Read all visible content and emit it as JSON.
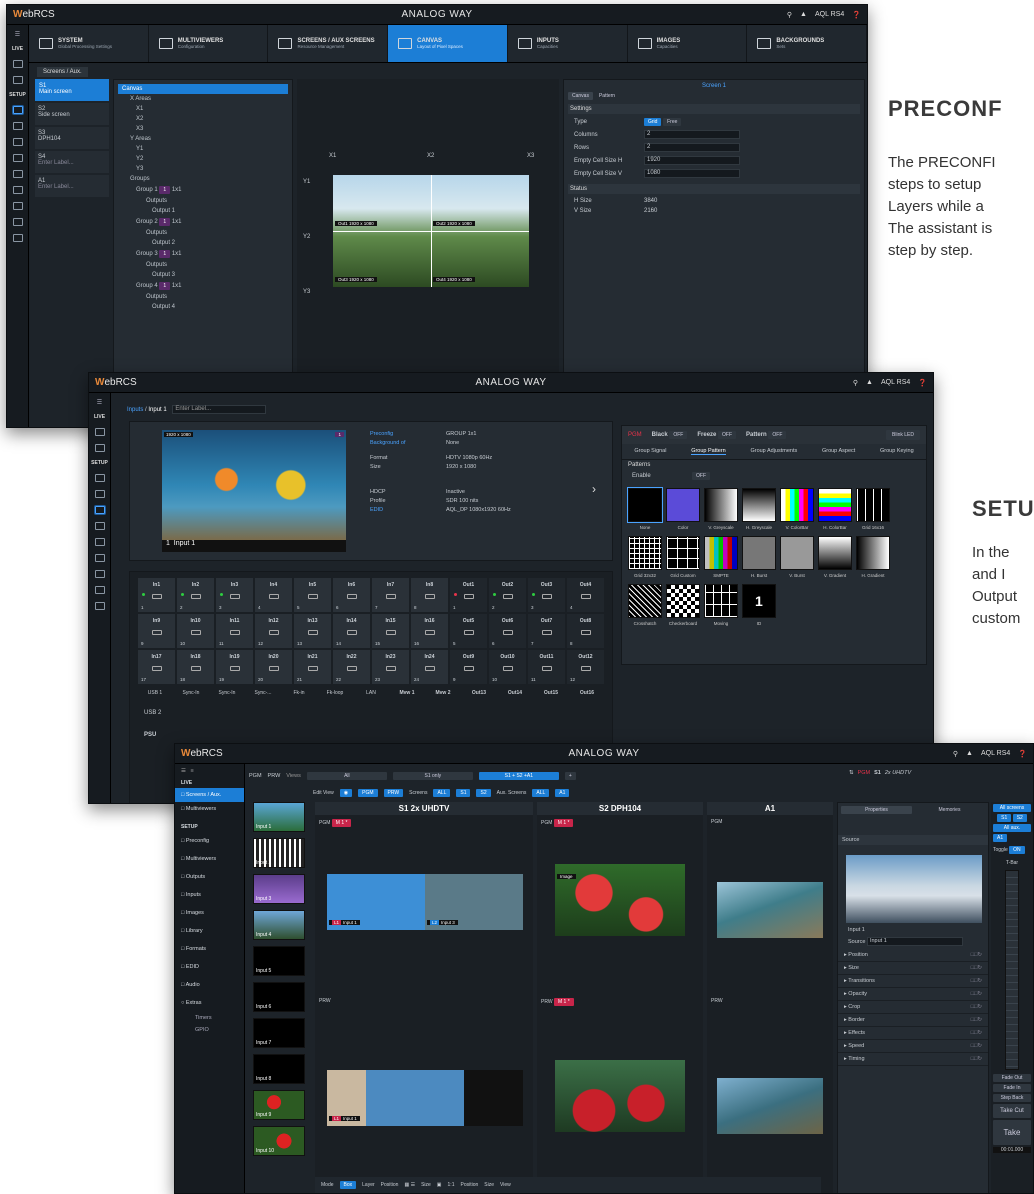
{
  "app": {
    "logo_w": "W",
    "logo_rest": "ebRCS",
    "brand": "ANALOG WAY",
    "device": "AQL RS4"
  },
  "side_text": {
    "s1_title": "PRECONF",
    "s1_body": [
      "The PRECONFI",
      "steps to setup",
      "Layers while a",
      "The assistant is",
      "step by step."
    ],
    "s2_title": "SETU",
    "s2_body": [
      "In the",
      "and I",
      "Output",
      "custom"
    ]
  },
  "s1": {
    "nav_live": "LIVE",
    "nav_setup": "SETUP",
    "tabs": [
      {
        "t": "SYSTEM",
        "s": "Global Processing Settings"
      },
      {
        "t": "MULTIVIEWERS",
        "s": "Configuration"
      },
      {
        "t": "SCREENS / AUX SCREENS",
        "s": "Resource Management"
      },
      {
        "t": "CANVAS",
        "s": "Layout of Pixel Spaces"
      },
      {
        "t": "INPUTS",
        "s": "Capacities"
      },
      {
        "t": "IMAGES",
        "s": "Capacities"
      },
      {
        "t": "BACKGROUNDS",
        "s": "Sets"
      }
    ],
    "subtab": "Screens / Aux.",
    "screens": [
      {
        "id": "S1",
        "label": "Main screen"
      },
      {
        "id": "S2",
        "label": "Side screen"
      },
      {
        "id": "S3",
        "label": "DPH104"
      },
      {
        "id": "S4",
        "label": "Enter Label..."
      },
      {
        "id": "A1",
        "label": "Enter Label..."
      }
    ],
    "tree": [
      "Canvas",
      "X Areas",
      "X1",
      "X2",
      "X3",
      "Y Areas",
      "Y1",
      "Y2",
      "Y3",
      "Groups",
      "Group 1",
      "Outputs",
      "Output 1",
      "Group 2",
      "Outputs",
      "Output 2",
      "Group 3",
      "Outputs",
      "Output 3",
      "Group 4",
      "Outputs",
      "Output 4"
    ],
    "group_badge": "1",
    "group_size": "1x1",
    "canvas_x": [
      "X1",
      "X2",
      "X3"
    ],
    "canvas_y": [
      "Y1",
      "Y2",
      "Y3"
    ],
    "outs": [
      {
        "o": "Out1",
        "r": "1920 x 1080"
      },
      {
        "o": "Out2",
        "r": "1920 x 1080"
      },
      {
        "o": "Out3",
        "r": "1920 x 1080"
      },
      {
        "o": "Out4",
        "r": "1920 x 1080"
      }
    ],
    "screen_title": "Screen 1",
    "ptabs": [
      "Canvas",
      "Pattern"
    ],
    "settings": "Settings",
    "type_l": "Type",
    "type_a": "Grid",
    "type_b": "Free",
    "fields": [
      {
        "l": "Columns",
        "v": "2"
      },
      {
        "l": "Rows",
        "v": "2"
      },
      {
        "l": "Empty Cell Size H",
        "v": "1920"
      },
      {
        "l": "Empty Cell Size V",
        "v": "1080"
      }
    ],
    "status": "Status",
    "hsize_l": "H Size",
    "hsize": "3840",
    "vsize_l": "V Size",
    "vsize": "2160"
  },
  "s2": {
    "crumb_a": "Inputs",
    "crumb_b": "Input 1",
    "crumb_ph": "Enter Label...",
    "preview_res": "1920 x 1080",
    "preview_name": "Input 1",
    "preview_num": "1",
    "info": [
      {
        "l": "Preconfig",
        "v": "GROUP 1x1"
      },
      {
        "l": "Background of",
        "v": "None"
      },
      {
        "l": "Format",
        "v": "HDTV 1080p 60Hz"
      },
      {
        "l": "Size",
        "v": "1920 x 1080"
      },
      {
        "l": "HDCP",
        "v": "Inactive"
      },
      {
        "l": "Profile",
        "v": "SDR 100 nits"
      },
      {
        "l": "EDID",
        "v": "AQL_DP 1080x1920 60Hz"
      }
    ],
    "bar": {
      "pgm": "PGM",
      "black": "Black",
      "freeze": "Freeze",
      "pattern": "Pattern",
      "off": "OFF",
      "blink": "Blink LED"
    },
    "ptabs": [
      "Group Signal",
      "Group Pattern",
      "Group Adjustments",
      "Group Aspect",
      "Group Keying"
    ],
    "patterns_h": "Patterns",
    "enable_l": "Enable",
    "enable_v": "OFF",
    "patterns": [
      "None",
      "Color",
      "V. Greyscale",
      "H. Greyscale",
      "V. ColorBar",
      "H. ColorBar",
      "Grid 16x16",
      "Grid 32x32",
      "Grid Custom",
      "SMPTE",
      "H. Burst",
      "V. Burst",
      "V. Gradient",
      "H. Gradient",
      "Crosshatch",
      "Checkerboard",
      "Moving",
      "ID"
    ],
    "io": [
      "In1",
      "In2",
      "In3",
      "In4",
      "In5",
      "In6",
      "In7",
      "In8",
      "Out1",
      "Out2",
      "Out3",
      "Out4",
      "In9",
      "In10",
      "In11",
      "In12",
      "In13",
      "In14",
      "In15",
      "In16",
      "Out5",
      "Out6",
      "Out7",
      "Out8",
      "In17",
      "In18",
      "In19",
      "In20",
      "In21",
      "In22",
      "In23",
      "In24",
      "Out9",
      "Out10",
      "Out11",
      "Out12"
    ],
    "io_nums": [
      "1",
      "2",
      "3",
      "4",
      "5",
      "6",
      "7",
      "8",
      "1",
      "2",
      "3",
      "4",
      "9",
      "10",
      "11",
      "12",
      "13",
      "14",
      "15",
      "16",
      "5",
      "6",
      "7",
      "8",
      "17",
      "18",
      "19",
      "20",
      "21",
      "22",
      "23",
      "24",
      "9",
      "10",
      "11",
      "12"
    ],
    "bottom": [
      "USB 1",
      "Sync-In",
      "Sync-In",
      "Sync-...",
      "Fk-in",
      "Fk-loop",
      "LAN",
      "Mvw 1",
      "Mvw 2",
      "Out13",
      "Out14",
      "Out15",
      "Out16"
    ],
    "usb2": "USB 2",
    "psu": "PSU"
  },
  "s3": {
    "nav": [
      "LIVE",
      "Screens / Aux.",
      "Multiviewers",
      "SETUP",
      "Preconfig",
      "Multiviewers",
      "Outputs",
      "Inputs",
      "Images",
      "Library",
      "Formats",
      "EDID",
      "Audio",
      "Extras",
      "Timers",
      "GPIO"
    ],
    "pgm": "PGM",
    "prw": "PRW",
    "views": "Views",
    "view_tabs": [
      "All",
      "S1 only",
      "S1 + S2 +A1"
    ],
    "edit_view": "Edit View",
    "screens_l": "Screens",
    "aux_l": "Aux. Screens",
    "all": "ALL",
    "chips": [
      "S1",
      "S2",
      "A1"
    ],
    "right_title": "PGM",
    "right_sub": "S1",
    "right_fmt": "2x UHDTV",
    "cols": [
      {
        "t": "S1",
        "s": "2x UHDTV"
      },
      {
        "t": "S2",
        "s": "DPH104"
      },
      {
        "t": "A1",
        "s": ""
      }
    ],
    "m1": "M 1 *",
    "inputs": [
      "Input 1",
      "Input 2",
      "Input 3",
      "Input 4",
      "Input 5",
      "Input 6",
      "Input 7",
      "Input 8",
      "Input 9",
      "Input 10"
    ],
    "prop_tabs": [
      "Properties",
      "Memories"
    ],
    "source_h": "Source",
    "source_name": "Input 1",
    "source_l": "Source",
    "source_v": "Input 1",
    "props": [
      "Position",
      "Size",
      "Transitions",
      "Opacity",
      "Crop",
      "Border",
      "Effects",
      "Speed",
      "Timing"
    ],
    "far": {
      "all_screens": "All screens",
      "all_aux": "All aux.",
      "toggle": "Toggle",
      "on": "ON",
      "tbar": "T-Bar",
      "fade_out": "Fade Out",
      "fade_in": "Fade In",
      "step_back": "Step Back",
      "take_cut": "Take Cut",
      "take": "Take",
      "time": "00:01.000"
    },
    "toolbar": [
      "Mode",
      "Box",
      "Layer",
      "Position",
      "Size",
      "1:1",
      "Position",
      "Size",
      "View"
    ],
    "lbl_image": "Image",
    "layers": [
      {
        "l": "L1",
        "n": "Input 1"
      },
      {
        "l": "L2",
        "n": "Input 3"
      }
    ]
  }
}
